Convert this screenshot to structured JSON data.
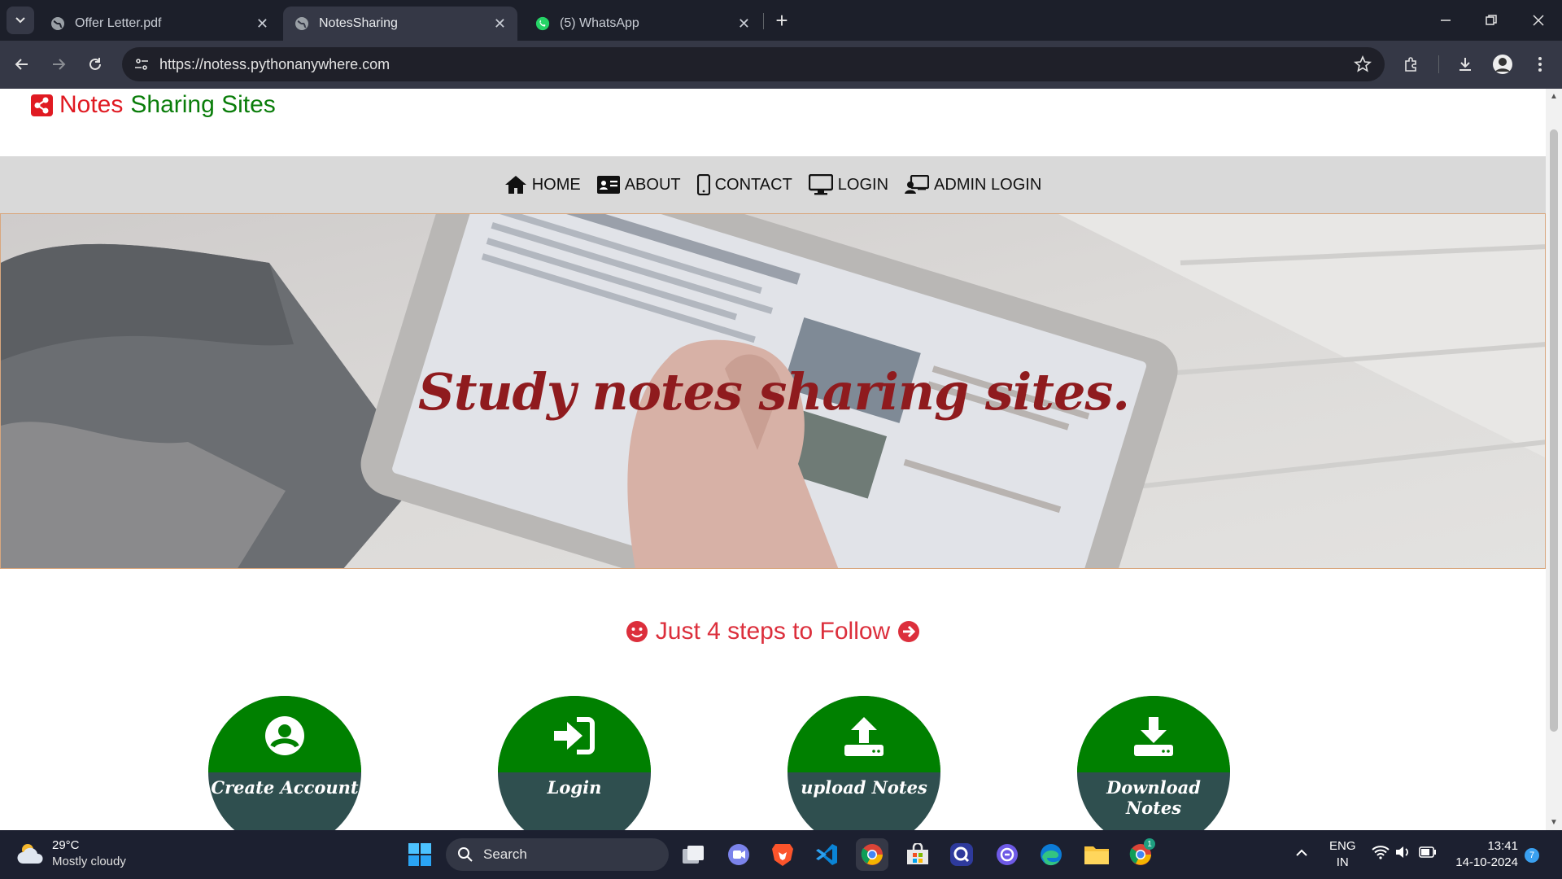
{
  "browser": {
    "tabs": [
      {
        "title": "Offer Letter.pdf",
        "icon": "globe-icon"
      },
      {
        "title": "NotesSharing",
        "icon": "globe-icon",
        "active": true
      },
      {
        "title": "(5) WhatsApp",
        "icon": "whatsapp-icon"
      }
    ],
    "new_tab_label": "+",
    "url": "https://notess.pythonanywhere.com"
  },
  "site": {
    "brand_word1": "Notes",
    "brand_word2": "Sharing Sites",
    "brand_colors": {
      "red": "#e01a22",
      "green": "#0a7d0a"
    },
    "nav": [
      {
        "label": "HOME",
        "icon": "home-icon"
      },
      {
        "label": "ABOUT",
        "icon": "id-card-icon"
      },
      {
        "label": "CONTACT",
        "icon": "mobile-icon"
      },
      {
        "label": "LOGIN",
        "icon": "desktop-icon"
      },
      {
        "label": "ADMIN LOGIN",
        "icon": "admin-icon"
      }
    ],
    "hero_tagline": "Study notes sharing sites.",
    "steps_heading": "Just 4 steps to Follow",
    "steps": [
      {
        "label": "Create Account",
        "icon": "user-circle-icon"
      },
      {
        "label": "Login",
        "icon": "sign-in-icon"
      },
      {
        "label": "upload Notes",
        "icon": "upload-icon"
      },
      {
        "label": "Download Notes",
        "icon": "download-icon"
      }
    ],
    "step_colors": {
      "top": "#008000",
      "bottom": "#2f4f4f"
    }
  },
  "taskbar": {
    "weather_temp": "29°C",
    "weather_desc": "Mostly cloudy",
    "search_placeholder": "Search",
    "lang_line1": "ENG",
    "lang_line2": "IN",
    "time": "13:41",
    "date": "14-10-2024",
    "notification_count": "7",
    "chrome_badge": "1"
  }
}
